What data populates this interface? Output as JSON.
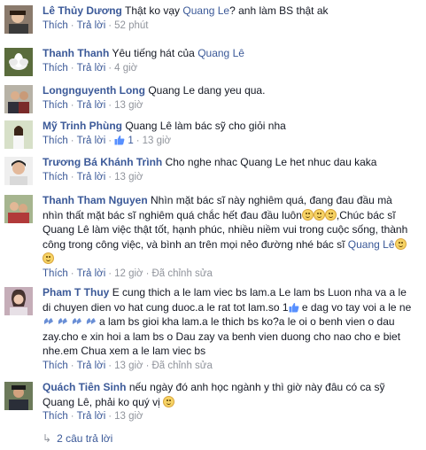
{
  "actions": {
    "like": "Thích",
    "reply": "Trả lời",
    "edited": "Đã chỉnh sửa",
    "sep": "·"
  },
  "comments": [
    {
      "name": "Lê Thủy Dương",
      "text": "Thật ko vạy",
      "link": "Quang Le",
      "text_after": "? anh làm BS thật ak",
      "time": "52 phút"
    },
    {
      "name": "Thanh Thanh",
      "text": "Yêu tiếng hát của",
      "link": "Quang Lê",
      "time": "4 giờ"
    },
    {
      "name": "Longnguyenth Long",
      "text": "Quang Le dang yeu qua.",
      "time": "13 giờ"
    },
    {
      "name": "Mỹ Trinh Phùng",
      "text": "Quang Lê làm bác sỹ cho giỏi nha",
      "likes": "1",
      "time": "13 giờ"
    },
    {
      "name": "Trương Bá Khánh Trình",
      "text": "Cho nghe nhac Quang Le het nhuc dau kaka",
      "time": "13 giờ"
    },
    {
      "name": "Thanh Tham Nguyen",
      "text_l1": "Nhìn mặt bác sĩ này nghiêm quá, đang đau đầu mà",
      "text_l2": "nhìn thất mặt bác sĩ nghiêm quá chắc hết đau đầu luôn",
      "text_l2b": ",Chúc bác sĩ",
      "text_l3": "Quang Lê làm việc thật tốt, hạnh phúc, nhiều niềm vui trong cuộc sống, thành",
      "text_l4": "công trong công việc, và bình an trên mọi nẻo đường nhé bác sĩ",
      "link": "Quang Lê",
      "time": "12 giờ"
    },
    {
      "name": "Pham T Thuy",
      "text_l1": "E cung thich a le lam viec bs lam.a Le lam bs Luon nha va a le",
      "text_l2": "di chuyen dien vo hat cung duoc.a le rat tot lam.so 1",
      "text_l2b": "e dag vo tay voi a le ne",
      "text_l3b": "a lam bs gioi kha lam.a le thich bs ko?a le oi o benh vien o dau",
      "text_l4": "zay.cho e xin hoi a lam bs o Dau zay va benh vien duong cho nao cho e biet",
      "text_l5": "nhe.em Chua xem a le lam viec bs",
      "time": "13 giờ"
    },
    {
      "name": "Quách Tiên Sinh",
      "text_l1": "nếu ngày đó anh học ngành y thì giờ này đâu có ca sỹ",
      "text_l2": "Quang Lê, phải ko quý vị",
      "time": "13 giờ"
    }
  ],
  "replies_link": "2 câu trả lời"
}
